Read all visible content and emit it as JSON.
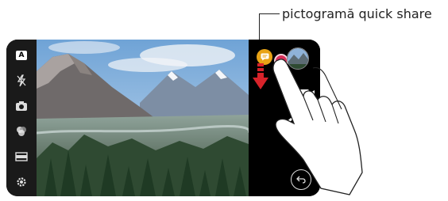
{
  "callout": {
    "label": "pictogramă quick share"
  },
  "left_toolbar": {
    "items": [
      {
        "icon": "auto-mode-icon",
        "label": "A"
      },
      {
        "icon": "flash-off-icon"
      },
      {
        "icon": "switch-camera-icon"
      },
      {
        "icon": "filter-icon"
      },
      {
        "icon": "aspect-ratio-icon"
      },
      {
        "icon": "settings-gear-icon"
      }
    ]
  },
  "right_controls": {
    "quick_share_icon": "quick-share-icon",
    "record_button": "record-button",
    "gallery_thumbnail": "gallery-thumbnail",
    "video_icon": "video-camera-icon",
    "shutter": "shutter-button",
    "back_icon": "back-icon"
  },
  "colors": {
    "quick_share_accent": "#e8a316",
    "record_accent": "#d92f5a",
    "arrow_red": "#d8232a"
  }
}
